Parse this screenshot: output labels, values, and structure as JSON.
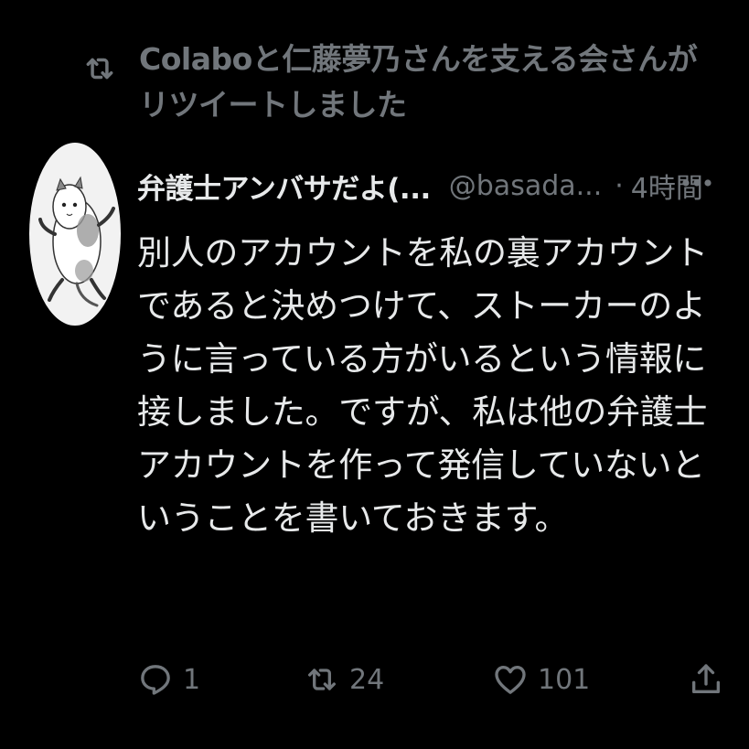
{
  "retweet_header": {
    "icon": "retweet-icon",
    "text": "Colaboと仁藤夢乃さんを支える会さんがリツイートしました"
  },
  "author": {
    "avatar": "cat-avatar",
    "display_name": "弁護士アンバサだよ(...",
    "handle": "@basada...",
    "separator": "·",
    "time": "4時間"
  },
  "more_icon": "more-dots-icon",
  "body": {
    "text": "別人のアカウントを私の裏アカウントであると決めつけて、ストーカーのように言っている方がいるという情報に接しました。ですが、私は他の弁護士アカウントを作って発信していないということを書いておきます。"
  },
  "actions": {
    "reply": {
      "icon": "reply-icon",
      "count": "1"
    },
    "retweet": {
      "icon": "retweet-icon",
      "count": "24"
    },
    "like": {
      "icon": "heart-icon",
      "count": "101"
    },
    "share": {
      "icon": "share-icon"
    }
  },
  "colors": {
    "background": "#000000",
    "text_primary": "#e7e9ea",
    "text_secondary": "#71767b"
  }
}
